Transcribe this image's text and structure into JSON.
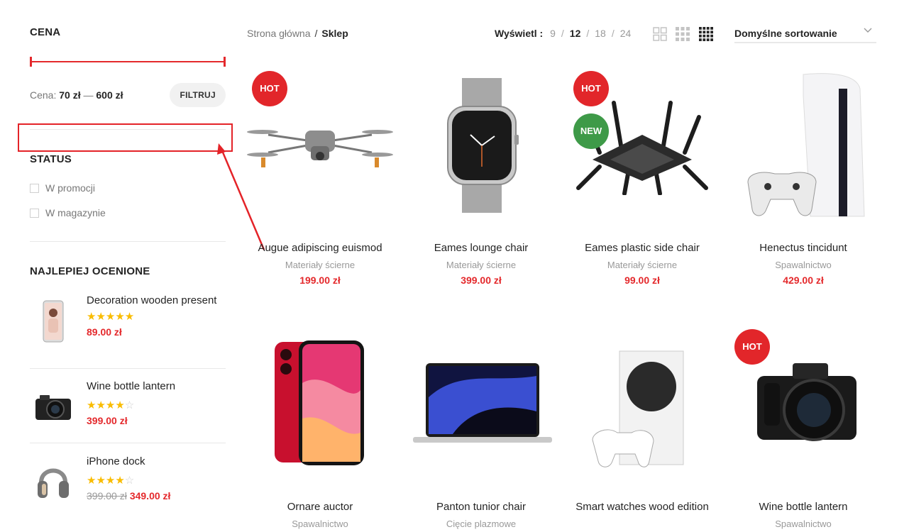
{
  "sidebar": {
    "price_title": "CENA",
    "price_label": "Cena:",
    "price_min": "70 zł",
    "price_dash": "—",
    "price_max": "600 zł",
    "filter_button": "FILTRUJ",
    "status_title": "STATUS",
    "status_options": [
      "W promocji",
      "W magazynie"
    ],
    "top_rated_title": "NAJLEPIEJ OCENIONE",
    "top_rated": [
      {
        "name": "Decoration wooden present",
        "rating": 5,
        "price": "89.00 zł",
        "old_price": "",
        "icon": "phone-icon"
      },
      {
        "name": "Wine bottle lantern",
        "rating": 4,
        "price": "399.00 zł",
        "old_price": "",
        "icon": "camera-icon"
      },
      {
        "name": "iPhone dock",
        "rating": 4,
        "price": "349.00 zł",
        "old_price": "399.00 zł",
        "icon": "headphones-icon"
      }
    ]
  },
  "toolbar": {
    "breadcrumb_home": "Strona główna",
    "breadcrumb_sep": "/",
    "breadcrumb_current": "Sklep",
    "perpage_label": "Wyświetl :",
    "perpage_options": [
      "9",
      "12",
      "18",
      "24"
    ],
    "perpage_active": "12",
    "sort_label": "Domyślne sortowanie"
  },
  "products": [
    {
      "name": "Augue adipiscing euismod",
      "category": "Materiały ścierne",
      "price": "199.00 zł",
      "badges": [
        "HOT"
      ],
      "icon": "drone-icon"
    },
    {
      "name": "Eames lounge chair",
      "category": "Materiały ścierne",
      "price": "399.00 zł",
      "badges": [],
      "icon": "smartwatch-icon"
    },
    {
      "name": "Eames plastic side chair",
      "category": "Materiały ścierne",
      "price": "99.00 zł",
      "badges": [
        "HOT",
        "NEW"
      ],
      "icon": "router-icon"
    },
    {
      "name": "Henectus tincidunt",
      "category": "Spawalnictwo",
      "price": "429.00 zł",
      "badges": [],
      "icon": "console-icon"
    },
    {
      "name": "Ornare auctor",
      "category": "Spawalnictwo",
      "price": "",
      "badges": [],
      "icon": "phone-icon"
    },
    {
      "name": "Panton tunior chair",
      "category": "Cięcie plazmowe",
      "price": "",
      "badges": [],
      "icon": "laptop-icon"
    },
    {
      "name": "Smart watches wood edition",
      "category": "",
      "price": "",
      "badges": [],
      "icon": "console-icon"
    },
    {
      "name": "Wine bottle lantern",
      "category": "Spawalnictwo",
      "price": "",
      "badges": [
        "HOT"
      ],
      "icon": "camera-icon"
    }
  ],
  "colors": {
    "accent": "#e4292c",
    "hot": "#e2262a",
    "new": "#3e9a48",
    "star": "#f9bc00"
  }
}
